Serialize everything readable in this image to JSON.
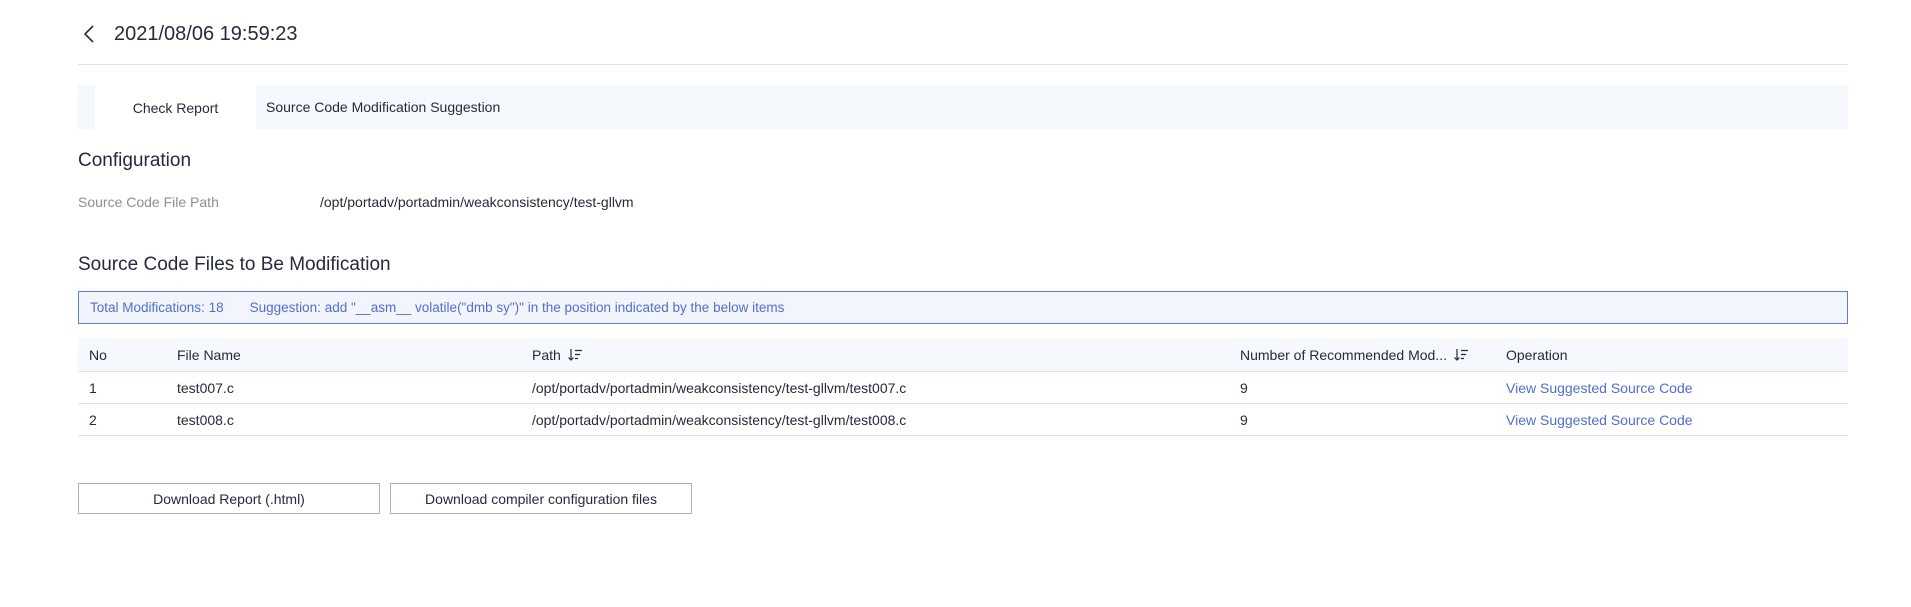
{
  "header": {
    "title": "2021/08/06 19:59:23",
    "back_icon": "chevron-left-icon"
  },
  "tabs": [
    {
      "label": "Check Report",
      "active": true
    },
    {
      "label": "Source Code Modification Suggestion",
      "active": false
    }
  ],
  "configuration": {
    "title": "Configuration",
    "source_path_label": "Source Code File Path",
    "source_path_value": "/opt/portadv/portadmin/weakconsistency/test-gllvm"
  },
  "files_section": {
    "title": "Source Code Files to Be Modification",
    "total_label": "Total Modifications",
    "total_value": "18",
    "suggestion_label": "Suggestion",
    "suggestion_text": "add \"__asm__ volatile(\"dmb sy\")\" in the position indicated by the below items"
  },
  "table": {
    "columns": [
      "No",
      "File Name",
      "Path",
      "Number of Recommended Mod...",
      "Operation"
    ],
    "rows": [
      {
        "no": "1",
        "file_name": "test007.c",
        "path": "/opt/portadv/portadmin/weakconsistency/test-gllvm/test007.c",
        "count": "9",
        "operation": "View Suggested Source Code"
      },
      {
        "no": "2",
        "file_name": "test008.c",
        "path": "/opt/portadv/portadmin/weakconsistency/test-gllvm/test008.c",
        "count": "9",
        "operation": "View Suggested Source Code"
      }
    ]
  },
  "buttons": {
    "download_report": "Download Report (.html)",
    "download_config": "Download compiler configuration files"
  },
  "colors": {
    "accent": "#526ecc",
    "info_border": "#5e7ce0",
    "tab_bar_bg": "#f5f8fd",
    "divider": "#dfe1e6"
  }
}
